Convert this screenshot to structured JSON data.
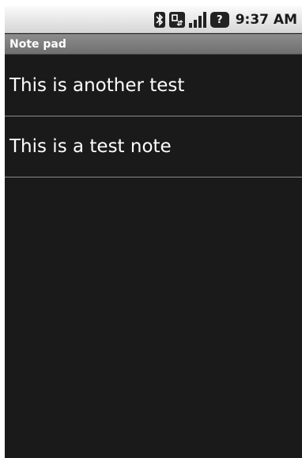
{
  "status_bar": {
    "icons": [
      "bluetooth-icon",
      "data-sync-icon",
      "signal-strength-icon",
      "alert-icon"
    ],
    "time": "9:37 AM"
  },
  "title_bar": {
    "title": "Note pad"
  },
  "notes": [
    {
      "title": "This is another test"
    },
    {
      "title": "This is a test note"
    }
  ]
}
